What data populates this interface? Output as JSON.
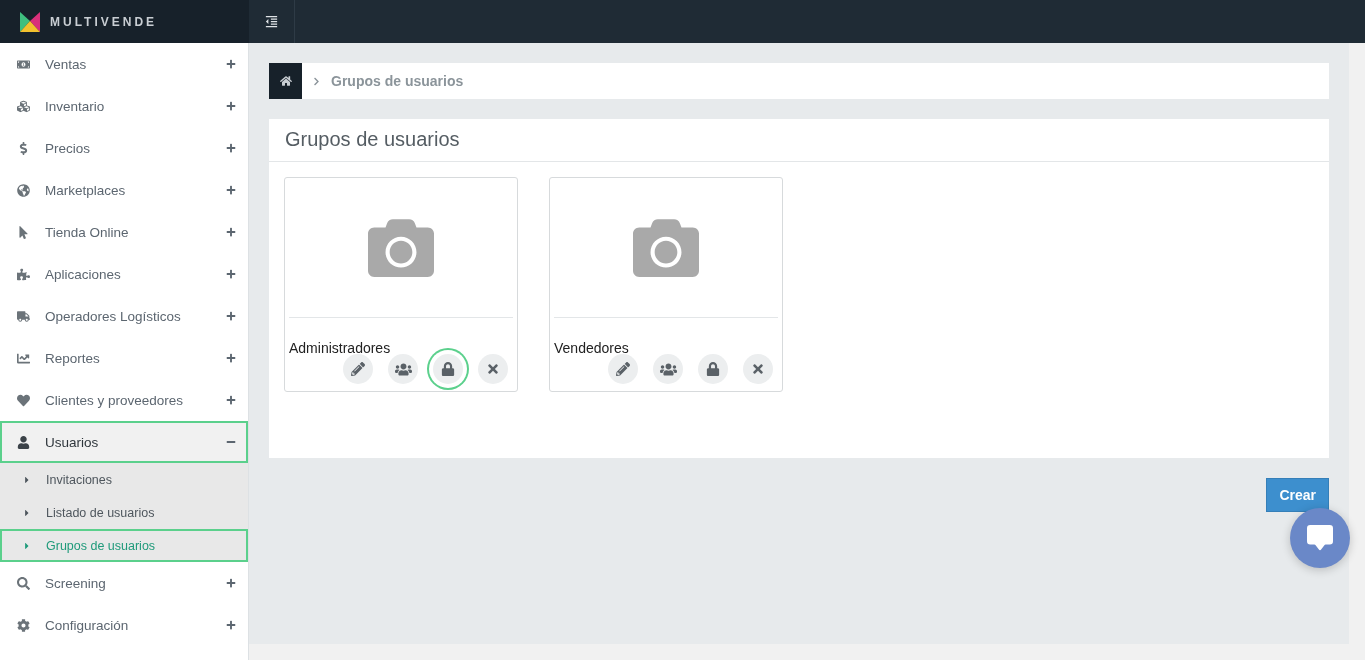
{
  "brand": {
    "name": "MULTIVENDE"
  },
  "sidebar": {
    "items": [
      {
        "label": "Ventas",
        "expanded": false,
        "highlighted": false
      },
      {
        "label": "Inventario",
        "expanded": false,
        "highlighted": false
      },
      {
        "label": "Precios",
        "expanded": false,
        "highlighted": false
      },
      {
        "label": "Marketplaces",
        "expanded": false,
        "highlighted": false
      },
      {
        "label": "Tienda Online",
        "expanded": false,
        "highlighted": false
      },
      {
        "label": "Aplicaciones",
        "expanded": false,
        "highlighted": false
      },
      {
        "label": "Operadores Logísticos",
        "expanded": false,
        "highlighted": false
      },
      {
        "label": "Reportes",
        "expanded": false,
        "highlighted": false
      },
      {
        "label": "Clientes y proveedores",
        "expanded": false,
        "highlighted": false
      },
      {
        "label": "Usuarios",
        "expanded": true,
        "highlighted": true,
        "children": [
          {
            "label": "Invitaciones",
            "selected": false,
            "highlighted": false
          },
          {
            "label": "Listado de usuarios",
            "selected": false,
            "highlighted": false
          },
          {
            "label": "Grupos de usuarios",
            "selected": true,
            "highlighted": true
          }
        ]
      },
      {
        "label": "Screening",
        "expanded": false,
        "highlighted": false
      },
      {
        "label": "Configuración",
        "expanded": false,
        "highlighted": false
      }
    ]
  },
  "breadcrumb": {
    "current": "Grupos de usuarios"
  },
  "panel": {
    "title": "Grupos de usuarios",
    "groups": [
      {
        "name": "Administradores",
        "actions": [
          {
            "highlighted": false
          },
          {
            "highlighted": false
          },
          {
            "highlighted": true
          },
          {
            "highlighted": false
          }
        ]
      },
      {
        "name": "Vendedores",
        "actions": [
          {
            "highlighted": false
          },
          {
            "highlighted": false
          },
          {
            "highlighted": false
          },
          {
            "highlighted": false
          }
        ]
      }
    ]
  },
  "create_button": "Crear"
}
